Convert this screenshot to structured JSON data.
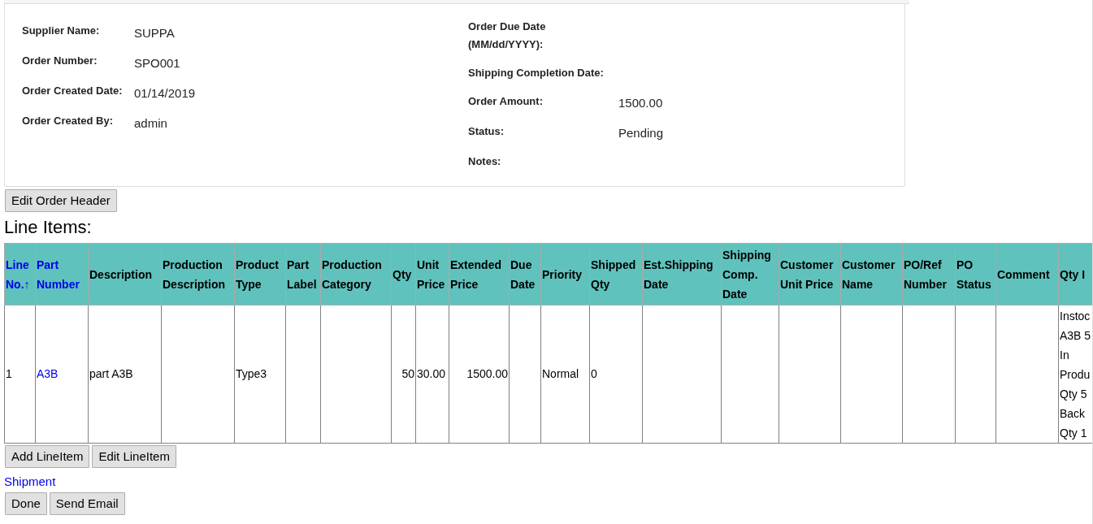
{
  "order_header": {
    "left_fields": [
      {
        "label": "Supplier Name:",
        "value": "SUPPA"
      },
      {
        "label": "Order Number:",
        "value": "SPO001"
      },
      {
        "label": "Order Created Date:",
        "value": "01/14/2019"
      },
      {
        "label": "Order Created By:",
        "value": "admin"
      }
    ],
    "right_fields": [
      {
        "label": "Order Due Date (MM/dd/YYYY):"
      },
      {
        "label": "Shipping Completion Date:"
      },
      {
        "label": "Order Amount:",
        "value": "1500.00"
      },
      {
        "label": "Status:",
        "value": "Pending"
      },
      {
        "label": "Notes:"
      }
    ]
  },
  "edit_header_button": "Edit Order Header",
  "line_items_title": "Line Items:",
  "table": {
    "columns": [
      {
        "label": "Line No.↑",
        "sortable": true
      },
      {
        "label": "Part Number",
        "sortable": true
      },
      {
        "label": "Description",
        "sortable": false
      },
      {
        "label": "Production Description",
        "sortable": false
      },
      {
        "label": "Product Type",
        "sortable": false
      },
      {
        "label": "Part Label",
        "sortable": false
      },
      {
        "label": "Production Category",
        "sortable": false
      },
      {
        "label": "Qty",
        "sortable": false
      },
      {
        "label": "Unit Price",
        "sortable": false
      },
      {
        "label": "Extended Price",
        "sortable": false
      },
      {
        "label": "Due Date",
        "sortable": false
      },
      {
        "label": "Priority",
        "sortable": false
      },
      {
        "label": "Shipped Qty",
        "sortable": false
      },
      {
        "label": "Est.Shipping Date",
        "sortable": false
      },
      {
        "label": "Shipping Comp. Date",
        "sortable": false
      },
      {
        "label": "Customer Unit Price",
        "sortable": false
      },
      {
        "label": "Customer Name",
        "sortable": false
      },
      {
        "label": "PO/Ref Number",
        "sortable": false
      },
      {
        "label": "PO Status",
        "sortable": false
      },
      {
        "label": "Comment",
        "sortable": false
      },
      {
        "label": "Qty I",
        "sortable": false
      }
    ],
    "rows": [
      {
        "cells": [
          {
            "text": "1"
          },
          {
            "text": "A3B",
            "kind": "link"
          },
          {
            "text": "part A3B"
          },
          {},
          {
            "text": "Type3"
          },
          {},
          {},
          {
            "text": "50",
            "kind": "number"
          },
          {
            "text": "30.00"
          },
          {
            "text": "1500.00",
            "kind": "number"
          },
          {},
          {
            "text": "Normal"
          },
          {
            "text": "0"
          },
          {},
          {},
          {},
          {},
          {},
          {},
          {},
          {
            "lines": [
              "Instoc",
              "A3B 5",
              "In",
              "Produ",
              "Qty 5",
              "Back",
              "Qty 1"
            ]
          }
        ]
      }
    ]
  },
  "line_buttons": [
    "Add LineItem",
    "Edit LineItem"
  ],
  "shipment_link": "Shipment",
  "bottom_buttons": [
    "Done",
    "Send Email"
  ]
}
